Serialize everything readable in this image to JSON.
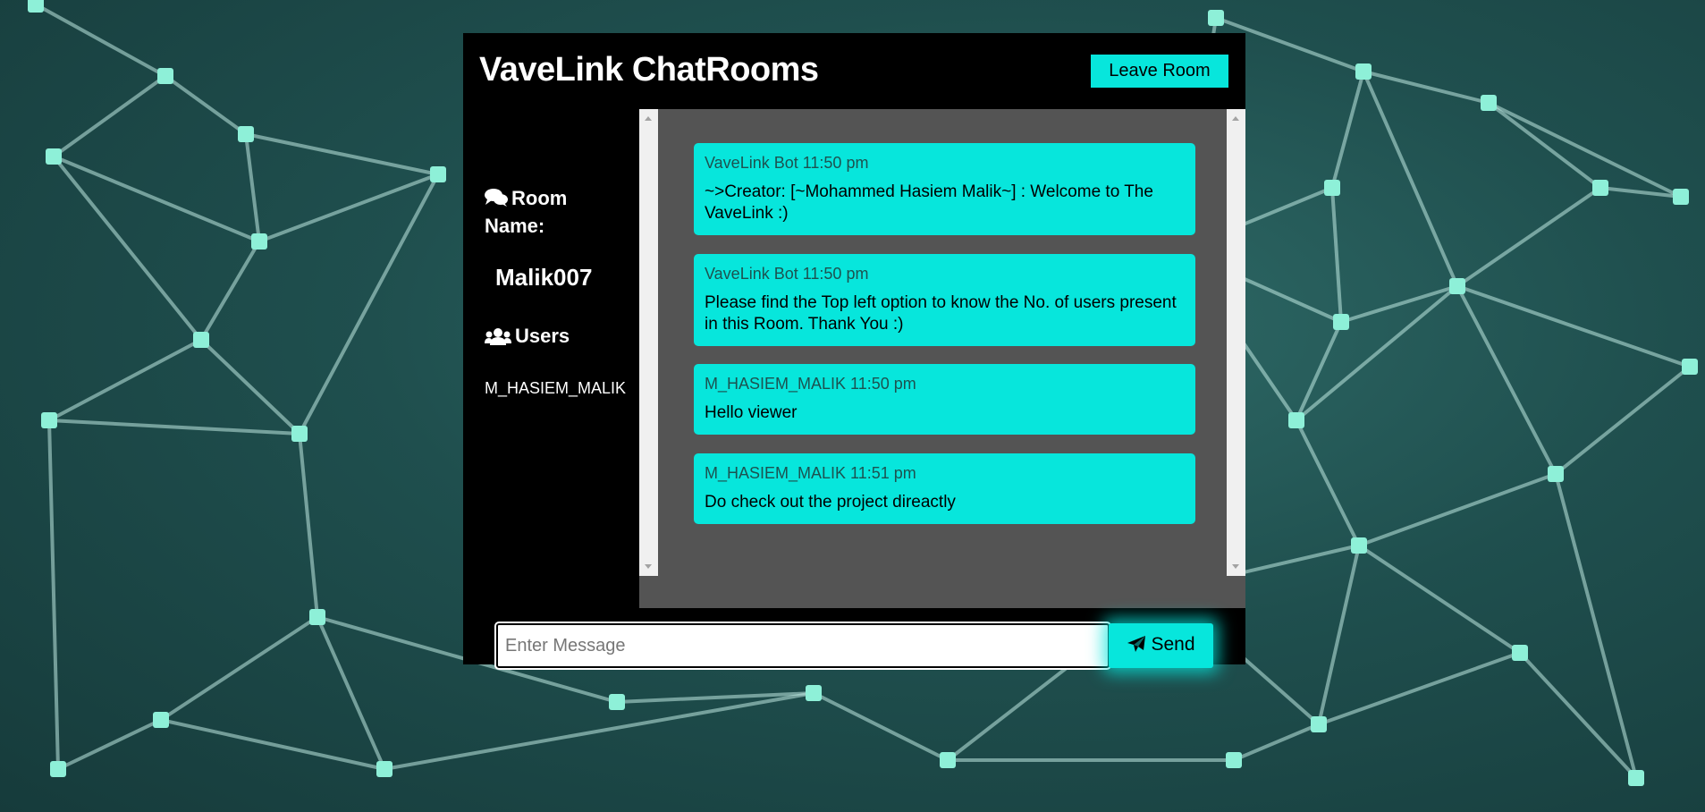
{
  "app": {
    "title": "VaveLink ChatRooms",
    "leave_label": "Leave Room"
  },
  "sidebar": {
    "room_heading": "Room Name:",
    "room_heading_icon": "comments-icon",
    "room_name": "Malik007",
    "users_heading": "Users",
    "users_heading_icon": "users-icon",
    "users": [
      "M_HASIEM_MALIK"
    ]
  },
  "messages": [
    {
      "meta": "VaveLink Bot 11:50 pm",
      "text": "~>Creator: [~Mohammed Hasiem Malik~] : Welcome to The VaveLink :)"
    },
    {
      "meta": "VaveLink Bot 11:50 pm",
      "text": "Please find the Top left option to know the No. of users present in this Room. Thank You :)"
    },
    {
      "meta": "M_HASIEM_MALIK 11:50 pm",
      "text": "Hello viewer"
    },
    {
      "meta": "M_HASIEM_MALIK 11:51 pm",
      "text": "Do check out the project direactly"
    }
  ],
  "composer": {
    "placeholder": "Enter Message",
    "value": "",
    "send_label": "Send",
    "send_icon": "paper-plane-icon"
  },
  "colors": {
    "accent": "#07e6dc",
    "panel": "#000000",
    "messages_bg": "#545454"
  }
}
